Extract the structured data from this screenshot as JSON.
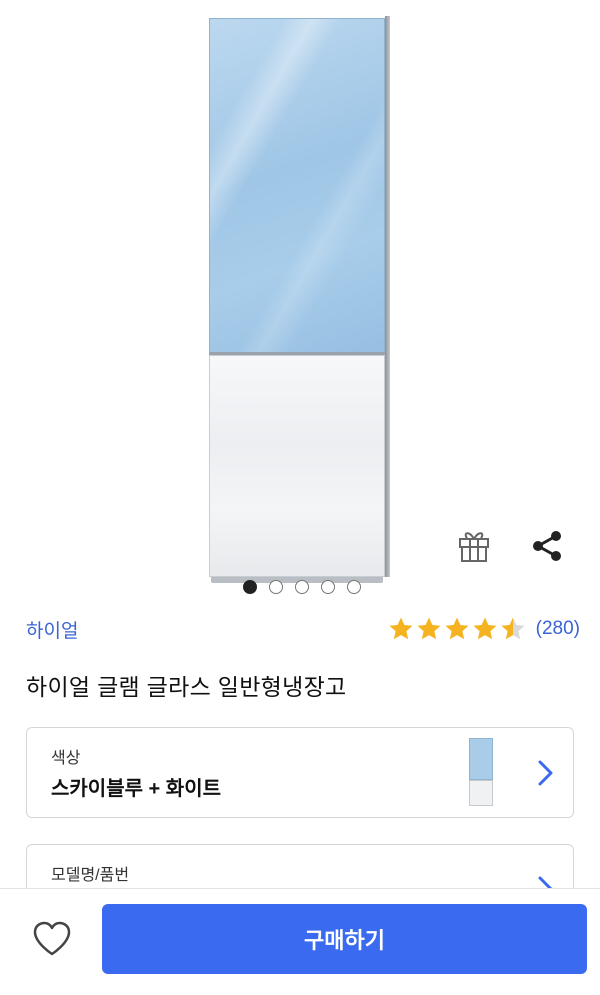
{
  "product": {
    "brand": "하이얼",
    "title": "하이얼 글램 글라스 일반형냉장고",
    "rating": 4.5,
    "rating_max": 5,
    "review_count": "(280)",
    "image_count": 5,
    "active_image_index": 0
  },
  "options": {
    "color": {
      "label": "색상",
      "value": "스카이블루 + 화이트"
    },
    "model": {
      "label": "모델명/품번"
    }
  },
  "actions": {
    "buy_label": "구매하기",
    "icons": {
      "gift": "gift-icon",
      "share": "share-icon",
      "wishlist": "heart-icon",
      "chevron": "chevron-right-icon"
    }
  },
  "colors": {
    "accent": "#3a6af0",
    "brand_text": "#3a63d6",
    "star": "#f5b321",
    "star_empty": "#d9d9d9",
    "fridge_top": "#a9cde9",
    "fridge_bottom": "#f0f1f3"
  }
}
